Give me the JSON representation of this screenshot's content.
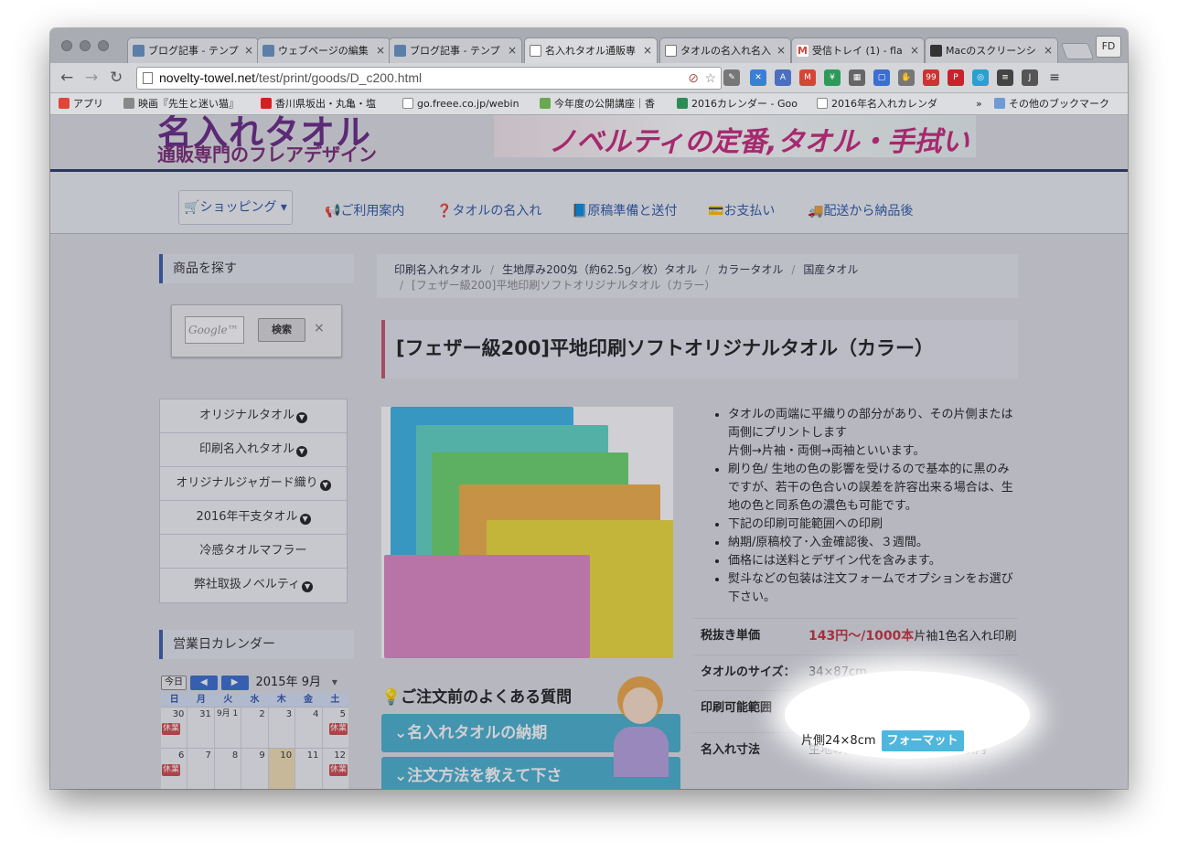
{
  "browser": {
    "tabs": [
      {
        "label": "ブログ記事 - テンプ",
        "icon_color": "#5b7fa8"
      },
      {
        "label": "ウェブページの編集",
        "icon_color": "#5b7fa8"
      },
      {
        "label": "ブログ記事 - テンプ",
        "icon_color": "#5b7fa8"
      },
      {
        "label": "名入れタオル通販専",
        "icon_color": "#d0d0d0"
      },
      {
        "label": "タオルの名入れ名入",
        "icon_color": "#d0d0d0"
      },
      {
        "label": "受信トレイ (1) - fla",
        "icon_color": "#d44638"
      },
      {
        "label": "Macのスクリーンシ",
        "icon_color": "#333333"
      }
    ],
    "profile": "FD",
    "url_host": "novelty-towel.net",
    "url_path": "/test/print/goods/D_c200.html",
    "bookmarks": [
      {
        "label": "アプリ",
        "icon_color": "#e0463a"
      },
      {
        "label": "映画『先生と迷い猫』",
        "icon_color": "#888888"
      },
      {
        "label": "香川県坂出・丸亀・塩",
        "icon_color": "#d12222"
      },
      {
        "label": "go.freee.co.jp/webin",
        "icon_color": "#cccccc"
      },
      {
        "label": "今年度の公開講座｜香",
        "icon_color": "#6aa84f"
      },
      {
        "label": "2016カレンダー - Goo",
        "icon_color": "#2e8b57"
      },
      {
        "label": "2016年名入れカレンダ",
        "icon_color": "#cccccc"
      }
    ],
    "bookmarks_more": "»",
    "other_bookmarks": "その他のブックマーク"
  },
  "site": {
    "logo": "名入れタオル",
    "logo_sub": "通販専門のフレアデザイン",
    "banner_text": "ノベルティの定番,タオル・手拭い"
  },
  "nav": {
    "shopping": "ショッピング",
    "items": [
      "ご利用案内",
      "タオルの名入れ",
      "原稿準備と送付",
      "お支払い",
      "配送から納品後"
    ]
  },
  "sidebar": {
    "find_heading": "商品を探す",
    "search_placeholder": "Google™ カスタム検索",
    "search_button": "検索",
    "search_clear": "×",
    "categories": [
      "オリジナルタオル",
      "印刷名入れタオル",
      "オリジナルジャガード織り",
      "2016年干支タオル",
      "冷感タオルマフラー",
      "弊社取扱ノベルティ"
    ],
    "calendar_heading": "営業日カレンダー",
    "calendar": {
      "today_button": "今日",
      "month": "2015年 9月",
      "weekdays": [
        "日",
        "月",
        "火",
        "水",
        "木",
        "金",
        "土"
      ],
      "weeks": [
        [
          "30",
          "31",
          "9月 1",
          "2",
          "3",
          "4",
          "5"
        ],
        [
          "6",
          "7",
          "8",
          "9",
          "10",
          "11",
          "12"
        ]
      ],
      "closed_label": "休業"
    }
  },
  "breadcrumb": {
    "items": [
      "印刷名入れタオル",
      "生地厚み200匁（約62.5g／枚）タオル",
      "カラータオル",
      "国産タオル"
    ],
    "current": "[フェザー級200]平地印刷ソフトオリジナルタオル（カラー）"
  },
  "product": {
    "title": "[フェザー級200]平地印刷ソフトオリジナルタオル（カラー）",
    "features": [
      "タオルの両端に平織りの部分があり、その片側または両側にプリントします\n片側→片袖・両側→両袖といいます。",
      "刷り色/ 生地の色の影響を受けるので基本的に黒のみですが、若干の色合いの誤差を許容出来る場合は、生地の色と同系色の濃色も可能です。",
      "下記の印刷可能範囲への印刷",
      "納期/原稿校了･入金確認後、３週間。",
      "価格には送料とデザイン代を含みます。",
      "熨斗などの包装は注文フォームでオプションをお選び下さい。"
    ],
    "specs": {
      "price_label": "税抜き単価",
      "price_value": "143円〜/1000本",
      "price_suffix": "片袖1色名入れ印刷",
      "size_label": "タオルのサイズ：",
      "size_value": "34×87cm",
      "print_area_label": "印刷可能範囲",
      "print_area_value": "片側24×8cm",
      "format_button": "フォーマット",
      "name_size_label": "名入れ寸法",
      "name_size_value": "生地の両端部各所上記サイズ以内"
    }
  },
  "faq": {
    "title": "ご注文前のよくある質問",
    "items": [
      "名入れタオルの納期",
      "注文方法を教えて下さ"
    ]
  }
}
